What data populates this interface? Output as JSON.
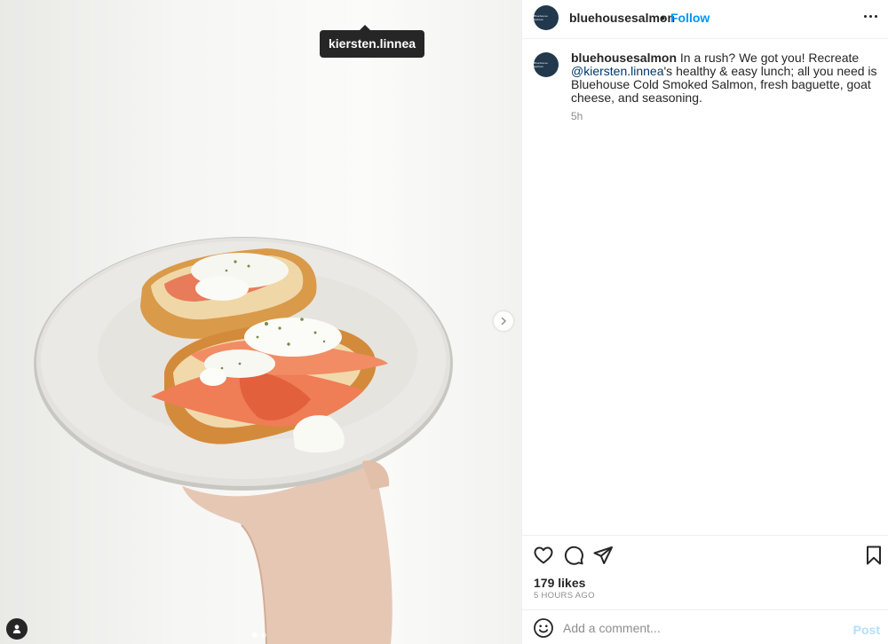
{
  "post": {
    "author": "bluehousesalmon",
    "follow_label": "Follow",
    "separator": "•",
    "avatar_text": "Bluehouse Salmon",
    "caption_text_1": " In a rush? We got you! Recreate ",
    "caption_mention": "@kiersten.linnea",
    "caption_text_2": "'s healthy & easy lunch; all you need is Bluehouse Cold Smoked Salmon, fresh baguette, goat cheese, and seasoning.",
    "caption_time": "5h",
    "likes": "179 likes",
    "time_ago": "5 HOURS AGO"
  },
  "media": {
    "tag_label": "kiersten.linnea",
    "carousel_count": 2,
    "carousel_active": 0,
    "description_icon": "plate-of-salmon-toast-photo"
  },
  "comment": {
    "placeholder": "Add a comment...",
    "post_label": "Post"
  },
  "colors": {
    "accent": "#0095f6",
    "mention": "#00376b",
    "post_disabled": "#b2dffc",
    "avatar_bg": "#21384d"
  },
  "icons": {
    "more": "more-options-icon",
    "like": "heart-icon",
    "comment": "comment-bubble-icon",
    "share": "paper-plane-icon",
    "save": "bookmark-icon",
    "emoji": "emoji-icon",
    "next": "chevron-right-icon",
    "tags": "user-tag-icon"
  }
}
